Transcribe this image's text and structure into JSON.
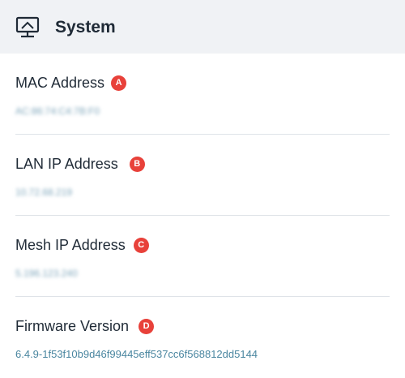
{
  "header": {
    "title": "System",
    "icon": "monitor-icon"
  },
  "fields": [
    {
      "label": "MAC Address",
      "badge": "A",
      "value": "AC:86:74:C4:7B:F0",
      "blurred": true
    },
    {
      "label": "LAN IP Address",
      "badge": "B",
      "value": "10.72.68.219",
      "blurred": true
    },
    {
      "label": "Mesh IP Address",
      "badge": "C",
      "value": "5.196.123.240",
      "blurred": true
    },
    {
      "label": "Firmware Version",
      "badge": "D",
      "value": "6.4.9-1f53f10b9d46f99445eff537cc6f568812dd5144",
      "blurred": false
    }
  ],
  "colors": {
    "badge": "#e8413a",
    "header_bg": "#f0f2f5",
    "value_text": "#4a86a0"
  }
}
